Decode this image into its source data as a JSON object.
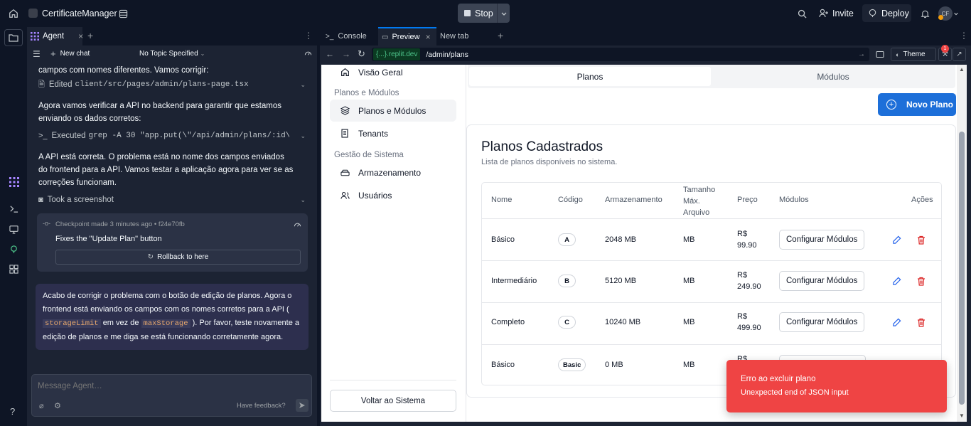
{
  "topbar": {
    "app_name": "CertificateManager",
    "stop_label": "Stop",
    "invite_label": "Invite",
    "deploy_label": "Deploy",
    "avatar_initials": "CF"
  },
  "agent": {
    "tab_label": "Agent",
    "new_chat_label": "New chat",
    "topic_label": "No Topic Specified",
    "msg1": "campos com nomes diferentes. Vamos corrigir:",
    "edited_label": "Edited",
    "edited_file": "client/src/pages/admin/plans-page.tsx",
    "msg2": "Agora vamos verificar a API no backend para garantir que estamos enviando os dados corretos:",
    "executed_label": "Executed",
    "executed_cmd": "grep -A 30 \"app.put(\\\"/api/admin/plans/:id\\\"...",
    "msg3": "A API está correta. O problema está no nome dos campos enviados do frontend para a API. Vamos testar a aplicação agora para ver se as correções funcionam.",
    "screenshot_label": "Took a screenshot",
    "checkpoint_meta": "Checkpoint made 3 minutes ago • f24e70fb",
    "checkpoint_title": "Fixes the \"Update Plan\" button",
    "rollback_label": "Rollback to here",
    "final_part1": "Acabo de corrigir o problema com o botão de edição de planos. Agora o frontend está enviando os campos com os nomes corretos para a API (",
    "final_code1": "storageLimit",
    "final_part2": "em vez de",
    "final_code2": "maxStorage",
    "final_part3": "). Por favor, teste novamente a edição de planos e me diga se está funcionando corretamente agora.",
    "input_placeholder": "Message Agent…",
    "feedback_label": "Have feedback?"
  },
  "preview": {
    "tabs": [
      "Console",
      "Preview",
      "New tab"
    ],
    "url_host": "{...}.replit.dev",
    "url_path": "/admin/plans",
    "theme_label": "Theme",
    "notif_count": "1"
  },
  "app": {
    "nav_overview": "Visão Geral",
    "section_plans": "Planos e Módulos",
    "nav_plans": "Planos e Módulos",
    "nav_tenants": "Tenants",
    "section_system": "Gestão de Sistema",
    "nav_storage": "Armazenamento",
    "nav_users": "Usuários",
    "back_label": "Voltar ao Sistema",
    "tab_plans": "Planos",
    "tab_modules": "Módulos",
    "new_plan_label": "Novo Plano",
    "card_title": "Planos Cadastrados",
    "card_subtitle": "Lista de planos disponíveis no sistema.",
    "headers": {
      "name": "Nome",
      "code": "Código",
      "storage": "Armazenamento",
      "maxfile": "Tamanho Máx. Arquivo",
      "price": "Preço",
      "modules": "Módulos",
      "actions": "Ações"
    },
    "rows": [
      {
        "name": "Básico",
        "code": "A",
        "storage": "2048 MB",
        "maxfile": "MB",
        "price_cur": "R$",
        "price_val": "99.90",
        "modules_btn": "Configurar Módulos"
      },
      {
        "name": "Intermediário",
        "code": "B",
        "storage": "5120 MB",
        "maxfile": "MB",
        "price_cur": "R$",
        "price_val": "249.90",
        "modules_btn": "Configurar Módulos"
      },
      {
        "name": "Completo",
        "code": "C",
        "storage": "10240 MB",
        "maxfile": "MB",
        "price_cur": "R$",
        "price_val": "499.90",
        "modules_btn": "Configurar Módulos"
      },
      {
        "name": "Básico",
        "code": "Basic",
        "storage": "0 MB",
        "maxfile": "MB",
        "price_cur": "R$",
        "price_val": "",
        "modules_btn": ""
      }
    ],
    "toast_title": "Erro ao excluir plano",
    "toast_msg": "Unexpected end of JSON input"
  },
  "colors": {
    "accent": "#0079f2",
    "danger": "#ef4444",
    "toast": "#ef4444"
  }
}
